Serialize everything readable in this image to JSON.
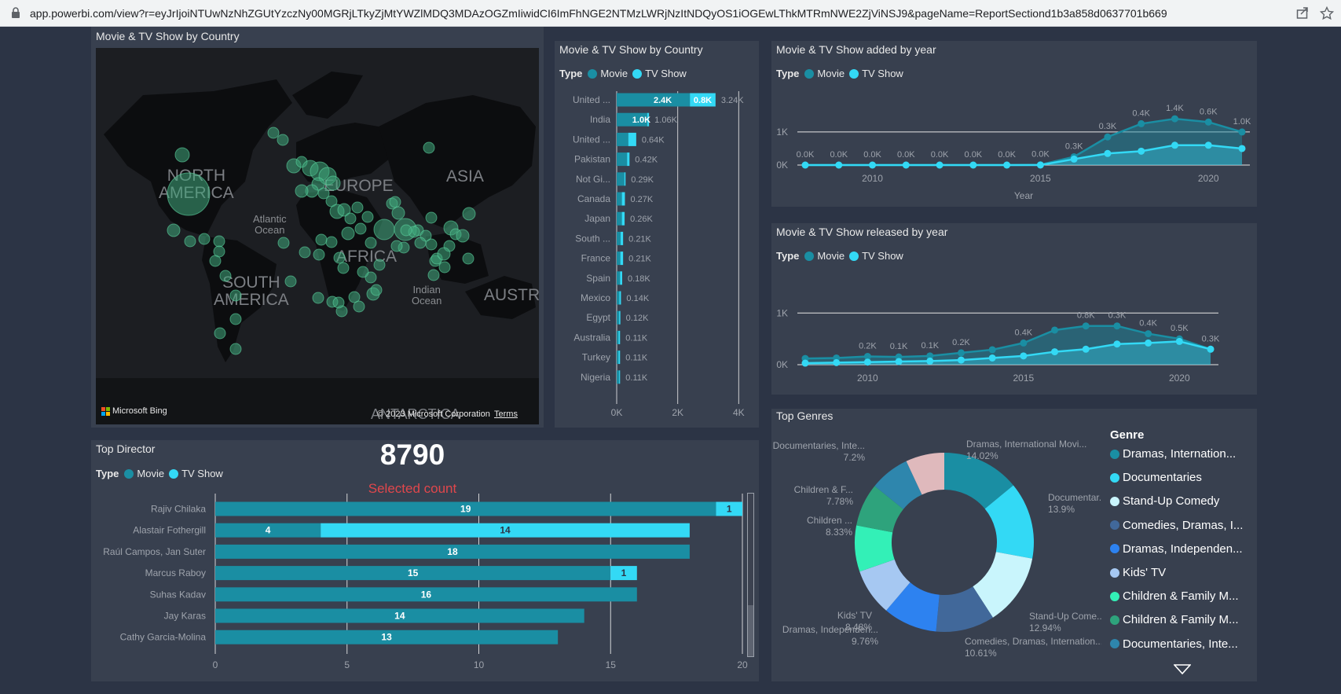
{
  "browser": {
    "url": "app.powerbi.com/view?r=eyJrIjoiNTUwNzNhZGUtYzczNy00MGRjLTkyZjMtYWZlMDQ3MDAzOGZmIiwidCI6ImFhNGE2NTMzLWRjNzItNDQyOS1iOGEwLThkMTRmNWE2ZjViNSJ9&pageName=ReportSectiond1b3a858d0637701b669"
  },
  "colors": {
    "movie": "#1a8ea3",
    "tvshow": "#33d9f5",
    "bg": "#2c3445",
    "panel": "#38404f"
  },
  "legend": {
    "title": "Type",
    "movie": "Movie",
    "tvshow": "TV Show"
  },
  "map": {
    "title": "Movie & TV Show by Country",
    "labels": {
      "na": "NORTH\nAMERICA",
      "sa": "SOUTH\nAMERICA",
      "europe": "EUROPE",
      "africa": "AFRICA",
      "asia": "ASIA",
      "austr": "AUSTRA",
      "atlantic": "Atlantic\nOcean",
      "indian": "Indian\nOcean",
      "antarctica": "ANTARCTICA"
    },
    "bing": "Microsoft Bing",
    "copyright": "© 2023 Microsoft Corporation",
    "terms": "Terms"
  },
  "country_chart": {
    "title": "Movie & TV Show by Country",
    "chart_data": {
      "type": "bar",
      "categories": [
        "United ...",
        "India",
        "United ...",
        "Pakistan",
        "Not Gi...",
        "Canada",
        "Japan",
        "South ...",
        "France",
        "Spain",
        "Mexico",
        "Egypt",
        "Australia",
        "Turkey",
        "Nigeria"
      ],
      "series": [
        {
          "name": "Movie",
          "values": [
            2.4,
            1.0,
            0.38,
            0.34,
            0.25,
            0.17,
            0.17,
            0.13,
            0.12,
            0.11,
            0.09,
            0.08,
            0.06,
            0.06,
            0.08
          ]
        },
        {
          "name": "TV Show",
          "values": [
            0.84,
            0.06,
            0.26,
            0.08,
            0.04,
            0.1,
            0.09,
            0.08,
            0.09,
            0.07,
            0.05,
            0.04,
            0.05,
            0.05,
            0.03
          ]
        }
      ],
      "totals": [
        "3.24K",
        "1.06K",
        "0.64K",
        "0.42K",
        "0.29K",
        "0.27K",
        "0.26K",
        "0.21K",
        "0.21K",
        "0.18K",
        "0.14K",
        "0.12K",
        "0.11K",
        "0.11K",
        "0.11K"
      ],
      "inner_labels": {
        "0": [
          "2.4K",
          "0.8K"
        ],
        "1": [
          "1.0K",
          ""
        ]
      },
      "xlim": [
        0,
        4.3
      ],
      "xticks": [
        "0K",
        "2K",
        "4K"
      ]
    }
  },
  "added_chart": {
    "title": "Movie & TV Show added by year",
    "chart_data": {
      "type": "area",
      "x": [
        2008,
        2009,
        2010,
        2011,
        2012,
        2013,
        2014,
        2015,
        2016,
        2017,
        2018,
        2019,
        2020,
        2021
      ],
      "series": [
        {
          "name": "Movie",
          "values": [
            0.0,
            0.0,
            0.0,
            0.0,
            0.0,
            0.0,
            0.0,
            0.01,
            0.25,
            0.85,
            1.25,
            1.4,
            1.3,
            1.0
          ]
        },
        {
          "name": "TV Show",
          "values": [
            0.0,
            0.0,
            0.0,
            0.0,
            0.0,
            0.0,
            0.0,
            0.0,
            0.18,
            0.35,
            0.42,
            0.6,
            0.6,
            0.5
          ]
        }
      ],
      "data_labels": [
        "0.0K",
        "0.0K",
        "0.0K",
        "0.0K",
        "0.0K",
        "0.0K",
        "0.0K",
        "0.0K",
        "0.3K",
        "0.3K",
        "0.4K",
        "1.4K",
        "0.6K",
        "1.0K"
      ],
      "ylim": [
        0,
        1.45
      ],
      "yticks": [
        "0K",
        "1K"
      ],
      "xticks": [
        "2010",
        "2015",
        "2020"
      ],
      "xlabel": "Year"
    }
  },
  "released_chart": {
    "title": "Movie & TV Show released by year",
    "chart_data": {
      "type": "area",
      "x": [
        2008,
        2009,
        2010,
        2011,
        2012,
        2013,
        2014,
        2015,
        2016,
        2017,
        2018,
        2019,
        2020,
        2021
      ],
      "series": [
        {
          "name": "Movie",
          "values": [
            0.12,
            0.13,
            0.16,
            0.15,
            0.17,
            0.23,
            0.29,
            0.42,
            0.67,
            0.75,
            0.75,
            0.6,
            0.5,
            0.3
          ]
        },
        {
          "name": "TV Show",
          "values": [
            0.03,
            0.04,
            0.05,
            0.06,
            0.07,
            0.09,
            0.13,
            0.17,
            0.25,
            0.3,
            0.4,
            0.42,
            0.45,
            0.3
          ]
        }
      ],
      "data_labels": [
        "",
        "",
        "0.2K",
        "0.1K",
        "0.1K",
        "0.2K",
        "",
        "0.4K",
        "",
        "0.8K",
        "0.3K",
        "0.4K",
        "0.5K",
        "0.3K"
      ],
      "ylim": [
        0,
        1.05
      ],
      "yticks": [
        "0K",
        "1K"
      ],
      "xticks": [
        "2010",
        "2015",
        "2020"
      ]
    }
  },
  "director_chart": {
    "title": "Top Director",
    "count": "8790",
    "count_label": "Selected count",
    "chart_data": {
      "type": "bar",
      "categories": [
        "Rajiv Chilaka",
        "Alastair Fothergill",
        "Raúl Campos, Jan Suter",
        "Marcus Raboy",
        "Suhas Kadav",
        "Jay Karas",
        "Cathy Garcia-Molina"
      ],
      "series": [
        {
          "name": "Movie",
          "values": [
            19,
            4,
            18,
            15,
            16,
            14,
            13
          ]
        },
        {
          "name": "TV Show",
          "values": [
            1,
            14,
            0,
            1,
            0,
            0,
            0
          ]
        }
      ],
      "xlim": [
        0,
        20
      ],
      "xticks": [
        "0",
        "5",
        "10",
        "15",
        "20"
      ]
    }
  },
  "genres_chart": {
    "title": "Top Genres",
    "legend_title": "Genre",
    "chart_data": {
      "type": "pie",
      "slices": [
        {
          "label": "Dramas, International Movi...",
          "pct": "14.02%",
          "value": 14.02,
          "color": "#1a8ea3"
        },
        {
          "label": "Documentar...",
          "pct": "13.9%",
          "value": 13.9,
          "color": "#33d9f5"
        },
        {
          "label": "Stand-Up Come...",
          "pct": "12.94%",
          "value": 12.94,
          "color": "#c9f5fc"
        },
        {
          "label": "Comedies, Dramas, Internation...",
          "pct": "10.61%",
          "value": 10.61,
          "color": "#41689a"
        },
        {
          "label": "Dramas, Independen...",
          "pct": "9.76%",
          "value": 9.76,
          "color": "#2d82f0"
        },
        {
          "label": "Kids' TV",
          "pct": "8.48%",
          "value": 8.48,
          "color": "#a6c8f2"
        },
        {
          "label": "Children ...",
          "pct": "8.33%",
          "value": 8.33,
          "color": "#33f0b7"
        },
        {
          "label": "Children & F...",
          "pct": "7.78%",
          "value": 7.78,
          "color": "#2ea37c"
        },
        {
          "label": "Documentaries, Inte...",
          "pct": "7.2%",
          "value": 7.2,
          "color": "#2e86ad"
        },
        {
          "label": "",
          "pct": "",
          "value": 6.98,
          "color": "#dfb9bc"
        }
      ]
    },
    "legend_items": [
      {
        "label": "Dramas, Internation...",
        "color": "#1a8ea3"
      },
      {
        "label": "Documentaries",
        "color": "#33d9f5"
      },
      {
        "label": "Stand-Up Comedy",
        "color": "#c9f5fc"
      },
      {
        "label": "Comedies, Dramas, I...",
        "color": "#41689a"
      },
      {
        "label": "Dramas, Independen...",
        "color": "#2d82f0"
      },
      {
        "label": "Kids' TV",
        "color": "#a6c8f2"
      },
      {
        "label": "Children & Family M...",
        "color": "#33f0b7"
      },
      {
        "label": "Children & Family M...",
        "color": "#2ea37c"
      },
      {
        "label": "Documentaries, Inte...",
        "color": "#2e86ad"
      }
    ]
  }
}
